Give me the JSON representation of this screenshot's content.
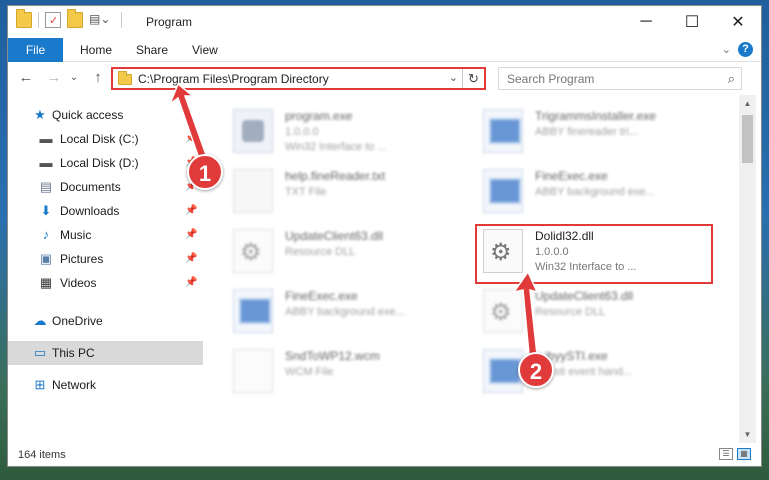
{
  "window": {
    "title": "Program",
    "controls": {
      "minimize": "─",
      "maximize": "☐",
      "close": "✕"
    }
  },
  "ribbon": {
    "tabs": [
      "File",
      "Home",
      "Share",
      "View"
    ],
    "help": "?",
    "collapse": "⌄"
  },
  "address": {
    "path": "C:\\Program Files\\Program Directory",
    "refresh": "↻",
    "dropdown": "⌄"
  },
  "search": {
    "placeholder": "Search Program",
    "icon": "search-icon"
  },
  "nav": {
    "back": "←",
    "forward": "→",
    "recent": "⌄",
    "up": "↑"
  },
  "sidebar": {
    "items": [
      {
        "label": "Quick access",
        "icon": "star-icon",
        "glyph": "★",
        "color": "#1979ca",
        "pinned": false
      },
      {
        "label": "Local Disk (C:)",
        "icon": "drive-icon",
        "glyph": "▬",
        "color": "#555555",
        "pinned": true
      },
      {
        "label": "Local Disk (D:)",
        "icon": "drive-icon",
        "glyph": "▬",
        "color": "#555555",
        "pinned": true
      },
      {
        "label": "Documents",
        "icon": "documents-icon",
        "glyph": "▤",
        "color": "#6b7a8f",
        "pinned": true
      },
      {
        "label": "Downloads",
        "icon": "downloads-icon",
        "glyph": "⬇",
        "color": "#1979ca",
        "pinned": true
      },
      {
        "label": "Music",
        "icon": "music-icon",
        "glyph": "♪",
        "color": "#1979ca",
        "pinned": true
      },
      {
        "label": "Pictures",
        "icon": "pictures-icon",
        "glyph": "▣",
        "color": "#5a7fa8",
        "pinned": true
      },
      {
        "label": "Videos",
        "icon": "videos-icon",
        "glyph": "▦",
        "color": "#333333",
        "pinned": true
      },
      {
        "label": "OneDrive",
        "icon": "cloud-icon",
        "glyph": "☁",
        "color": "#1979ca",
        "pinned": false
      },
      {
        "label": "This PC",
        "icon": "computer-icon",
        "glyph": "▭",
        "color": "#1979ca",
        "pinned": false
      },
      {
        "label": "Network",
        "icon": "network-icon",
        "glyph": "⊞",
        "color": "#1979ca",
        "pinned": false
      }
    ]
  },
  "files": [
    {
      "name": "program.exe",
      "sub1": "1.0.0.0",
      "sub2": "Win32 Interface to ...",
      "icon": "setup-icon"
    },
    {
      "name": "TrigrammsInstaller.exe",
      "sub1": "ABBY finereader tri...",
      "sub2": "",
      "icon": "exe-icon"
    },
    {
      "name": "help.fineReader.txt",
      "sub1": "TXT File",
      "sub2": "",
      "icon": "text-file-icon"
    },
    {
      "name": "FineExec.exe",
      "sub1": "ABBY background exe...",
      "sub2": "",
      "icon": "exe-icon"
    },
    {
      "name": "UpdateClient63.dll",
      "sub1": "Resource DLL",
      "sub2": "",
      "icon": "dll-icon"
    },
    {
      "name": "Dolidl32.dll",
      "sub1": "1.0.0.0",
      "sub2": "Win32 Interface to ...",
      "icon": "dll-icon"
    },
    {
      "name": "FineExec.exe",
      "sub1": "ABBY background exe...",
      "sub2": "",
      "icon": "exe-icon"
    },
    {
      "name": "UpdateClient63.dll",
      "sub1": "Resource DLL",
      "sub2": "",
      "icon": "dll-icon"
    },
    {
      "name": "SndToWP12.wcm",
      "sub1": "WCM File",
      "sub2": "",
      "icon": "wcm-file-icon"
    },
    {
      "name": "...ibyySTI.exe",
      "sub1": "...Y sti event hand...",
      "sub2": "",
      "icon": "exe-icon"
    }
  ],
  "status": {
    "item_count": "164 items"
  },
  "callouts": [
    "1",
    "2"
  ],
  "colors": {
    "accent": "#1979ca",
    "annotation": "#e03a3a"
  }
}
